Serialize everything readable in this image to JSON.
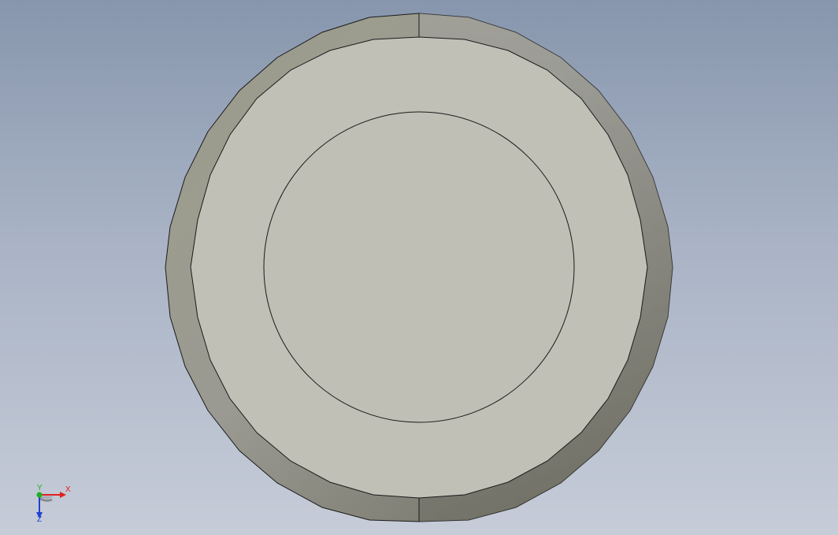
{
  "viewport": {
    "background_top": "#8796ad",
    "background_bottom": "#c6ccd8"
  },
  "part": {
    "view": "front",
    "outer_face_color_light": "#a8a89c",
    "outer_face_color_dark": "#6e6e62",
    "top_face_color": "#c0c0b6",
    "edge_color": "#1a1a1a"
  },
  "triad": {
    "x_label": "X",
    "y_label": "Y",
    "z_label": "Z",
    "x_color": "#e02020",
    "y_color": "#20b020",
    "z_color": "#2040d0"
  }
}
